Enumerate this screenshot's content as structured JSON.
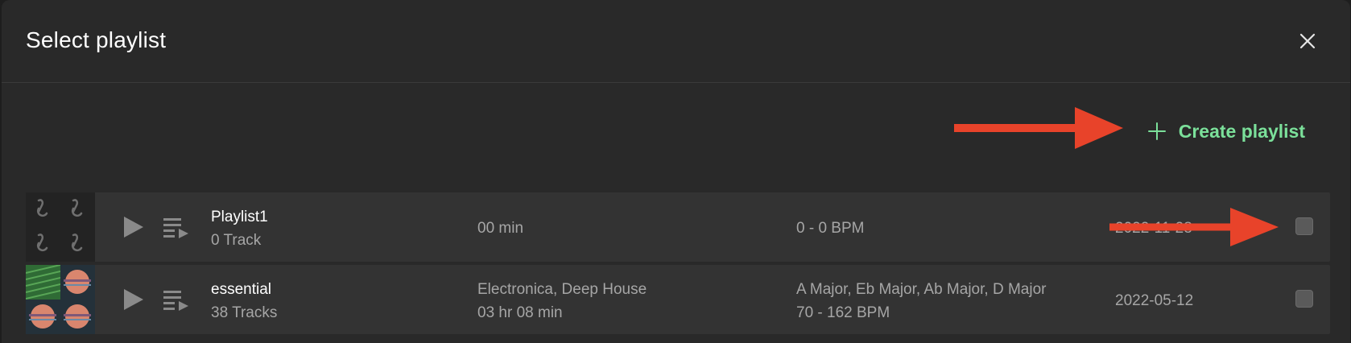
{
  "dialog": {
    "title": "Select playlist",
    "close_icon": "close-icon"
  },
  "toolbar": {
    "create_label": "Create playlist",
    "create_icon": "plus-icon",
    "accent_color": "#7be09a"
  },
  "annotation": {
    "arrow_color": "#e8432a"
  },
  "playlists": [
    {
      "name": "Playlist1",
      "tracks": "0 Track",
      "genres": "",
      "duration": "00 min",
      "keys": "",
      "bpm": "0 - 0 BPM",
      "date": "2022-11-28",
      "checked": false
    },
    {
      "name": "essential",
      "tracks": "38 Tracks",
      "genres": "Electronica, Deep House",
      "duration": "03 hr 08 min",
      "keys": "A Major, Eb Major, Ab Major, D Major",
      "bpm": "70 - 162 BPM",
      "date": "2022-05-12",
      "checked": false
    }
  ]
}
